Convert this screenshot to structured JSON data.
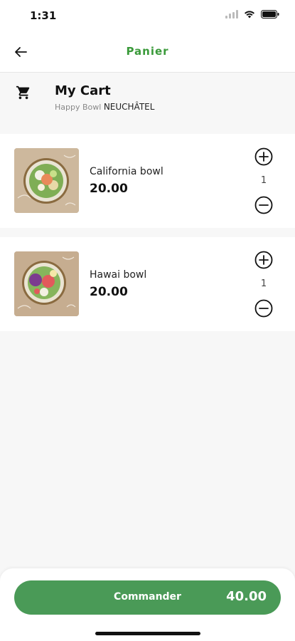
{
  "status_bar": {
    "time": "1:31"
  },
  "nav": {
    "title": "Panier"
  },
  "cart": {
    "title": "My Cart",
    "store_name": "Happy Bowl",
    "store_city": "NEUCHÂTEL"
  },
  "items": [
    {
      "name": "California bowl",
      "price": "20.00",
      "quantity": "1"
    },
    {
      "name": "Hawai bowl",
      "price": "20.00",
      "quantity": "1"
    }
  ],
  "order": {
    "label": "Commander",
    "total": "40.00"
  },
  "colors": {
    "accent": "#3a9a3a",
    "button": "#4a9a57"
  }
}
